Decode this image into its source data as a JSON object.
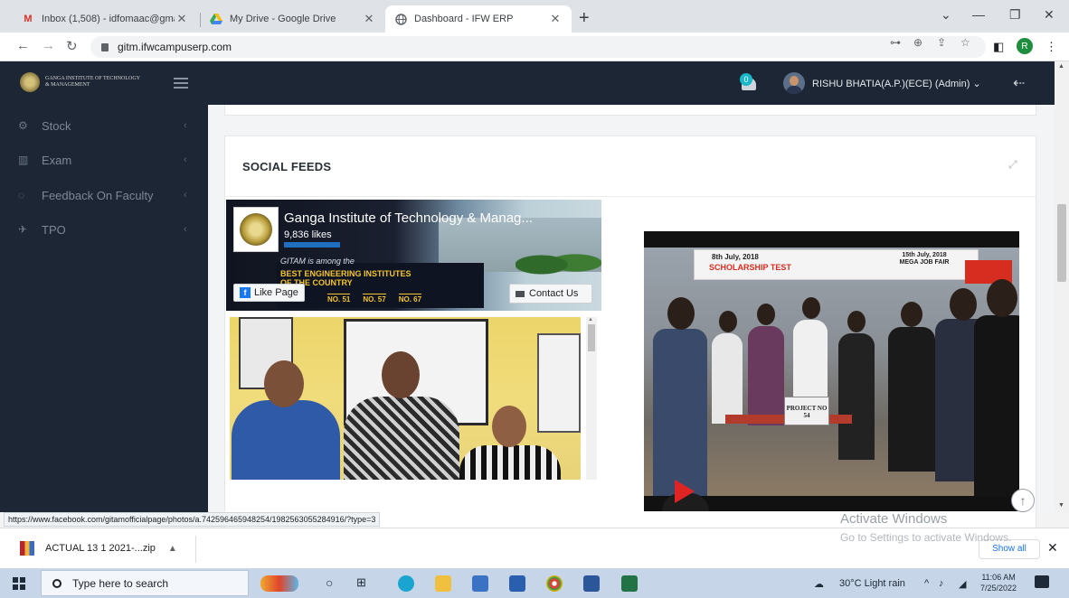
{
  "browser": {
    "tabs": [
      {
        "title": "Inbox (1,508) - idfomaac@gmail",
        "icon": "gmail-icon"
      },
      {
        "title": "My Drive - Google Drive",
        "icon": "drive-icon"
      },
      {
        "title": "Dashboard - IFW ERP",
        "icon": "globe-icon",
        "active": true
      }
    ],
    "url": "gitm.ifwcampuserp.com",
    "profile_initial": "R",
    "status_url": "https://www.facebook.com/gitamofficialpage/photos/a.742596465948254/1982563055284916/?type=3"
  },
  "app": {
    "logo_text": [
      "GANGA INSTITUTE OF TECHNOLOGY",
      "& MANAGEMENT"
    ],
    "notification_count": "0",
    "user_name": "RISHU BHATIA(A.P.)(ECE) (Admin)",
    "user_caret": "⌄"
  },
  "sidebar": {
    "items": [
      {
        "label": "Stock",
        "icon": "stock-icon"
      },
      {
        "label": "Exam",
        "icon": "exam-chart-icon"
      },
      {
        "label": "Feedback On Faculty",
        "icon": "feedback-icon"
      },
      {
        "label": "TPO",
        "icon": "plane-icon"
      }
    ]
  },
  "social": {
    "title": "SOCIAL FEEDS",
    "fb": {
      "page_name": "Ganga Institute of Technology & Manag...",
      "likes": "9,836 likes",
      "cover_line1": "GITAM is among the",
      "cover_line2": "BEST ENGINEERING INSTITUTES",
      "cover_line3": "OF THE COUNTRY",
      "ranks": [
        "NO. 51",
        "NO. 57",
        "NO. 67"
      ],
      "like_label": "Like Page",
      "contact_label": "Contact Us"
    },
    "video": {
      "banner_date": "8th July, 2018",
      "banner_title": "SCHOLARSHIP TEST",
      "banner_right": "15th July, 2018 MEGA JOB FAIR",
      "sign_text": "PROJECT NO 54"
    }
  },
  "watermark": {
    "line1": "Activate Windows",
    "line2": "Go to Settings to activate Windows."
  },
  "downloads": {
    "file_name": "ACTUAL 13 1 2021-...zip",
    "show_all": "Show all"
  },
  "taskbar": {
    "search_placeholder": "Type here to search",
    "weather": "30°C  Light rain",
    "time": "11:06 AM",
    "date": "7/25/2022"
  }
}
